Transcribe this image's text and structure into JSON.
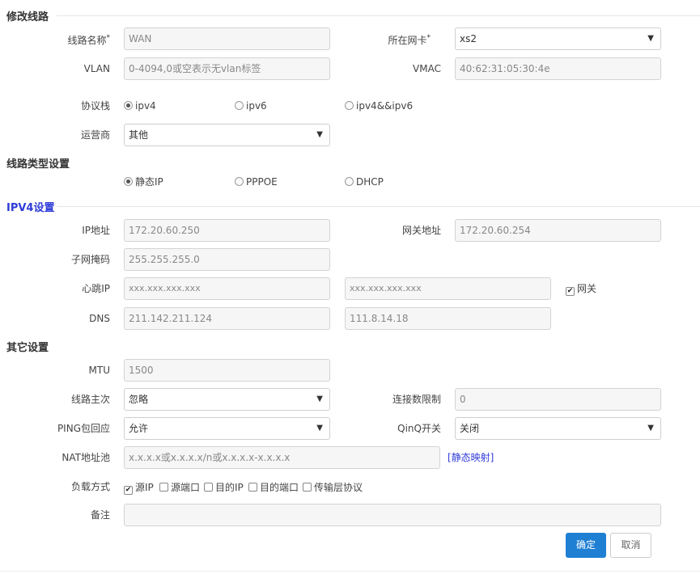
{
  "sections": {
    "edit_line": "修改线路",
    "line_type": "线路类型设置",
    "ipv4": "IPV4设置",
    "other": "其它设置"
  },
  "form": {
    "line_name": {
      "label": "线路名称",
      "required": "*",
      "value": "WAN"
    },
    "nic": {
      "label": "所在网卡",
      "required": "*",
      "value": "xs2"
    },
    "vlan": {
      "label": "VLAN",
      "placeholder": "0-4094,0或空表示无vlan标签"
    },
    "vmac": {
      "label": "VMAC",
      "value": "40:62:31:05:30:4e"
    },
    "protocol": {
      "label": "协议栈",
      "options": [
        "ipv4",
        "ipv6",
        "ipv4&&ipv6"
      ],
      "selected": "ipv4"
    },
    "isp": {
      "label": "运营商",
      "value": "其他"
    },
    "line_type_options": [
      "静态IP",
      "PPPOE",
      "DHCP"
    ],
    "line_type_selected": "静态IP",
    "ip": {
      "label": "IP地址",
      "value": "172.20.60.250"
    },
    "gateway": {
      "label": "网关地址",
      "value": "172.20.60.254"
    },
    "netmask": {
      "label": "子网掩码",
      "value": "255.255.255.0"
    },
    "heartbeat": {
      "label": "心跳IP",
      "placeholder1": "xxx.xxx.xxx.xxx",
      "placeholder2": "xxx.xxx.xxx.xxx",
      "gateway_check_label": "网关",
      "gateway_checked": true
    },
    "dns": {
      "label": "DNS",
      "value1": "211.142.211.124",
      "value2": "111.8.14.18"
    },
    "mtu": {
      "label": "MTU",
      "value": "1500"
    },
    "priority": {
      "label": "线路主次",
      "value": "忽略"
    },
    "conn_limit": {
      "label": "连接数限制",
      "value": "0"
    },
    "ping": {
      "label": "PING包回应",
      "value": "允许"
    },
    "qinq": {
      "label": "QinQ开关",
      "value": "关闭"
    },
    "nat_pool": {
      "label": "NAT地址池",
      "placeholder": "x.x.x.x或x.x.x.x/n或x.x.x.x-x.x.x.x",
      "link": "[静态映射]"
    },
    "load_balance": {
      "label": "负载方式",
      "options": [
        {
          "label": "源IP",
          "checked": true
        },
        {
          "label": "源端口",
          "checked": false
        },
        {
          "label": "目的IP",
          "checked": false
        },
        {
          "label": "目的端口",
          "checked": false
        },
        {
          "label": "传输层协议",
          "checked": false
        }
      ]
    },
    "remark": {
      "label": "备注",
      "value": ""
    }
  },
  "buttons": {
    "confirm": "确定",
    "cancel": "取消"
  },
  "icons": {
    "caret": "▼",
    "check": "✔"
  },
  "colors": {
    "primary": "#1f7fd3",
    "section_blue": "#2f3bd8"
  }
}
